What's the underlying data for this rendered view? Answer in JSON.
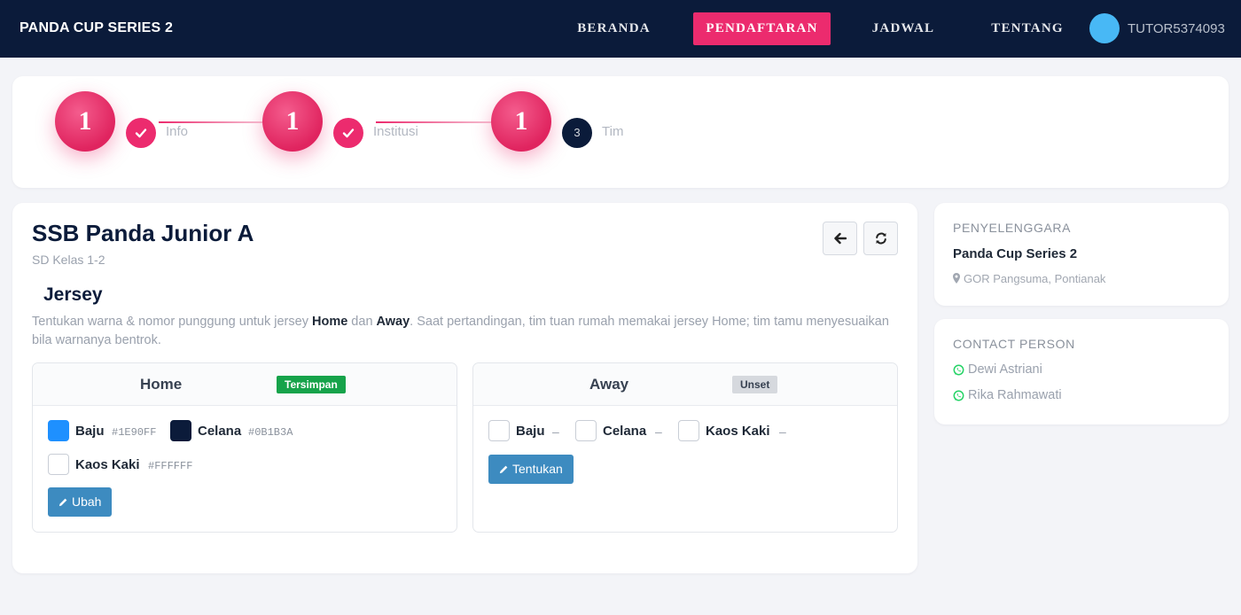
{
  "nav": {
    "brand": "PANDA CUP SERIES 2",
    "links": [
      "BERANDA",
      "PENDAFTARAN",
      "JADWAL",
      "TENTANG"
    ],
    "active_index": 1,
    "username": "TUTOR5374093",
    "avatar_color": "#48B8F5"
  },
  "stepper": {
    "steps": [
      {
        "big": "1",
        "label": "Info",
        "state": "done"
      },
      {
        "big": "1",
        "label": "Institusi",
        "state": "done"
      },
      {
        "big": "1",
        "number": "3",
        "label": "Tim",
        "state": "current"
      }
    ]
  },
  "team": {
    "name": "SSB Panda Junior A",
    "category": "SD Kelas 1-2"
  },
  "jersey": {
    "title": "Jersey",
    "desc_pre": "Tentukan warna & nomor punggung untuk jersey ",
    "desc_home": "Home",
    "desc_mid": " dan ",
    "desc_away": "Away",
    "desc_post": ". Saat pertandingan, tim tuan rumah memakai jersey Home; tim tamu menyesuaikan bila warnanya bentrok.",
    "home": {
      "title": "Home",
      "badge": "Tersimpan",
      "items": [
        {
          "label": "Baju",
          "value": "#1E90FF",
          "color": "#1E90FF"
        },
        {
          "label": "Celana",
          "value": "#0B1B3A",
          "color": "#0B1B3A"
        },
        {
          "label": "Kaos Kaki",
          "value": "#FFFFFF",
          "color": "#FFFFFF"
        }
      ],
      "button": "Ubah"
    },
    "away": {
      "title": "Away",
      "badge": "Unset",
      "items": [
        {
          "label": "Baju",
          "value": "–"
        },
        {
          "label": "Celana",
          "value": "–"
        },
        {
          "label": "Kaos Kaki",
          "value": "–"
        }
      ],
      "button": "Tentukan"
    }
  },
  "organizer": {
    "heading": "PENYELENGGARA",
    "name": "Panda Cup Series 2",
    "location": "GOR Pangsuma, Pontianak"
  },
  "contact": {
    "heading": "CONTACT PERSON",
    "people": [
      "Dewi Astriani",
      "Rika Rahmawati"
    ]
  },
  "colors": {
    "accent": "#EC2B6E",
    "navy": "#0B1B3A",
    "button": "#3D8BC0",
    "saved": "#16A34A"
  }
}
